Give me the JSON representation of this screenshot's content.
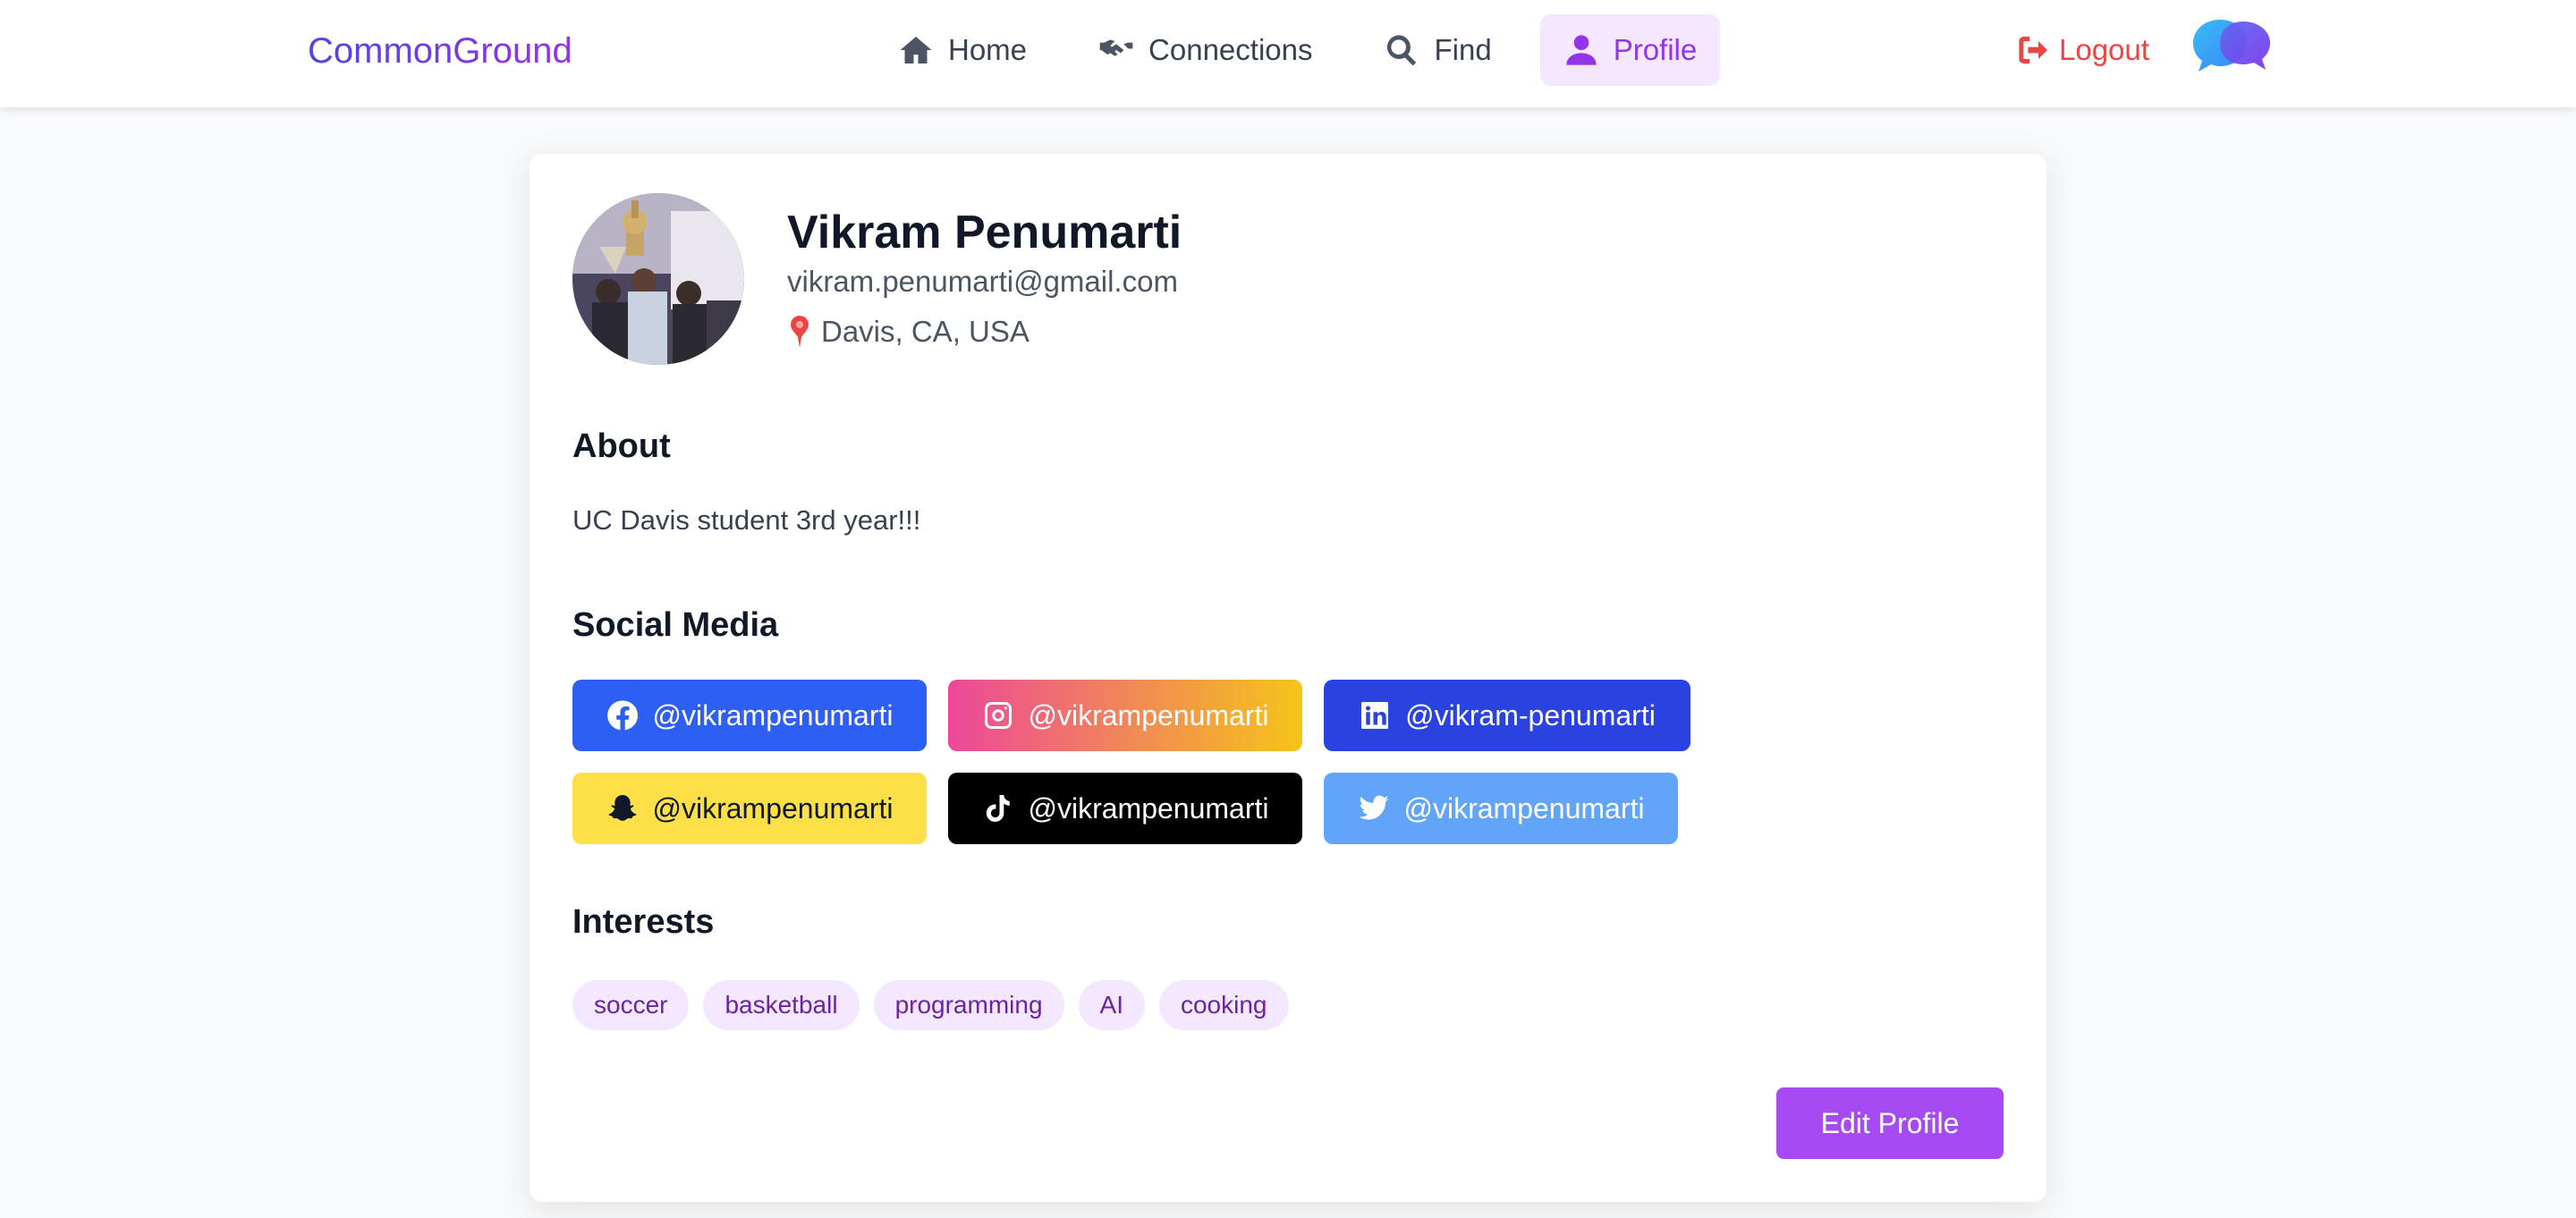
{
  "navbar": {
    "brand": "CommonGround",
    "links": [
      {
        "label": "Home",
        "icon": "home-icon"
      },
      {
        "label": "Connections",
        "icon": "handshake-icon"
      },
      {
        "label": "Find",
        "icon": "search-icon"
      },
      {
        "label": "Profile",
        "icon": "user-icon",
        "active": true
      }
    ],
    "logout_label": "Logout",
    "logo_icon": "chat-bubbles-icon"
  },
  "profile": {
    "name": "Vikram Penumarti",
    "email": "vikram.penumarti@gmail.com",
    "location": "Davis, CA, USA",
    "about_heading": "About",
    "about_text": "UC Davis student 3rd year!!!",
    "social_heading": "Social Media",
    "social": [
      {
        "platform": "facebook",
        "icon": "facebook-icon",
        "handle": "@vikrampenumarti",
        "color": "#2d5ff5"
      },
      {
        "platform": "instagram",
        "icon": "instagram-icon",
        "handle": "@vikrampenumarti",
        "color": "#ec4899"
      },
      {
        "platform": "linkedin",
        "icon": "linkedin-icon",
        "handle": "@vikram-penumarti",
        "color": "#2a42df"
      },
      {
        "platform": "snapchat",
        "icon": "snapchat-icon",
        "handle": "@vikrampenumarti",
        "color": "#fde047"
      },
      {
        "platform": "tiktok",
        "icon": "tiktok-icon",
        "handle": "@vikrampenumarti",
        "color": "#000000"
      },
      {
        "platform": "twitter",
        "icon": "twitter-icon",
        "handle": "@vikrampenumarti",
        "color": "#60a5fa"
      }
    ],
    "interests_heading": "Interests",
    "interests": [
      "soccer",
      "basketball",
      "programming",
      "AI",
      "cooking"
    ],
    "edit_label": "Edit Profile"
  },
  "colors": {
    "accent": "#9333ea",
    "accent_light": "#f3e8ff",
    "danger": "#ef4444"
  }
}
